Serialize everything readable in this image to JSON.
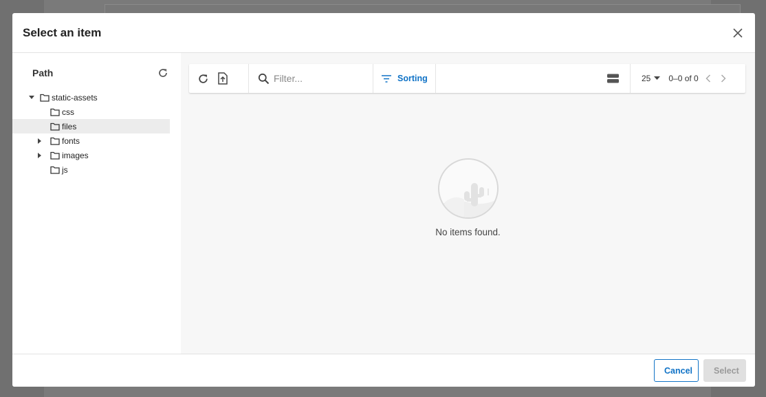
{
  "modal": {
    "title": "Select an item"
  },
  "sidebar": {
    "title": "Path",
    "tree": [
      {
        "label": "static-assets",
        "expanded": true,
        "depth": 0
      },
      {
        "label": "css",
        "depth": 1
      },
      {
        "label": "files",
        "depth": 1,
        "selected": true
      },
      {
        "label": "fonts",
        "depth": 1,
        "collapsed": true
      },
      {
        "label": "images",
        "depth": 1,
        "collapsed": true
      },
      {
        "label": "js",
        "depth": 1
      }
    ]
  },
  "toolbar": {
    "filter_placeholder": "Filter...",
    "sorting_label": "Sorting",
    "page_size": "25",
    "range": "0–0 of 0"
  },
  "empty": {
    "message": "No items found."
  },
  "footer": {
    "cancel_label": "Cancel",
    "select_label": "Select"
  },
  "colors": {
    "accent": "#0f72c6",
    "disabled_bg": "#e0e0e0"
  }
}
